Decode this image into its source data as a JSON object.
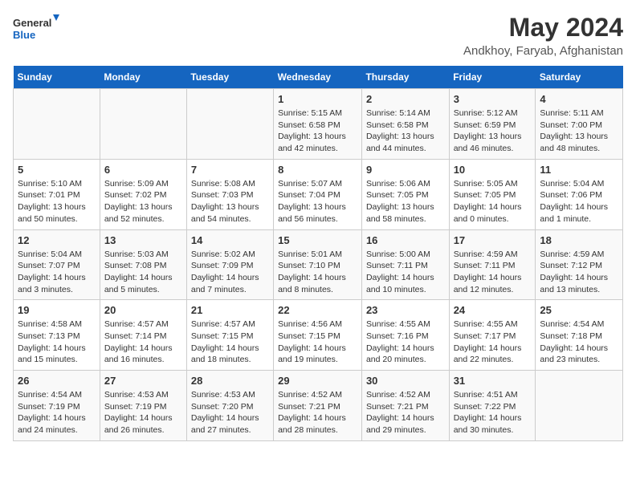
{
  "logo": {
    "general": "General",
    "blue": "Blue"
  },
  "title": "May 2024",
  "subtitle": "Andkhoy, Faryab, Afghanistan",
  "headers": [
    "Sunday",
    "Monday",
    "Tuesday",
    "Wednesday",
    "Thursday",
    "Friday",
    "Saturday"
  ],
  "weeks": [
    [
      {
        "day": "",
        "sunrise": "",
        "sunset": "",
        "daylight": ""
      },
      {
        "day": "",
        "sunrise": "",
        "sunset": "",
        "daylight": ""
      },
      {
        "day": "",
        "sunrise": "",
        "sunset": "",
        "daylight": ""
      },
      {
        "day": "1",
        "sunrise": "5:15 AM",
        "sunset": "6:58 PM",
        "daylight": "13 hours and 42 minutes."
      },
      {
        "day": "2",
        "sunrise": "5:14 AM",
        "sunset": "6:58 PM",
        "daylight": "13 hours and 44 minutes."
      },
      {
        "day": "3",
        "sunrise": "5:12 AM",
        "sunset": "6:59 PM",
        "daylight": "13 hours and 46 minutes."
      },
      {
        "day": "4",
        "sunrise": "5:11 AM",
        "sunset": "7:00 PM",
        "daylight": "13 hours and 48 minutes."
      }
    ],
    [
      {
        "day": "5",
        "sunrise": "5:10 AM",
        "sunset": "7:01 PM",
        "daylight": "13 hours and 50 minutes."
      },
      {
        "day": "6",
        "sunrise": "5:09 AM",
        "sunset": "7:02 PM",
        "daylight": "13 hours and 52 minutes."
      },
      {
        "day": "7",
        "sunrise": "5:08 AM",
        "sunset": "7:03 PM",
        "daylight": "13 hours and 54 minutes."
      },
      {
        "day": "8",
        "sunrise": "5:07 AM",
        "sunset": "7:04 PM",
        "daylight": "13 hours and 56 minutes."
      },
      {
        "day": "9",
        "sunrise": "5:06 AM",
        "sunset": "7:05 PM",
        "daylight": "13 hours and 58 minutes."
      },
      {
        "day": "10",
        "sunrise": "5:05 AM",
        "sunset": "7:05 PM",
        "daylight": "14 hours and 0 minutes."
      },
      {
        "day": "11",
        "sunrise": "5:04 AM",
        "sunset": "7:06 PM",
        "daylight": "14 hours and 1 minute."
      }
    ],
    [
      {
        "day": "12",
        "sunrise": "5:04 AM",
        "sunset": "7:07 PM",
        "daylight": "14 hours and 3 minutes."
      },
      {
        "day": "13",
        "sunrise": "5:03 AM",
        "sunset": "7:08 PM",
        "daylight": "14 hours and 5 minutes."
      },
      {
        "day": "14",
        "sunrise": "5:02 AM",
        "sunset": "7:09 PM",
        "daylight": "14 hours and 7 minutes."
      },
      {
        "day": "15",
        "sunrise": "5:01 AM",
        "sunset": "7:10 PM",
        "daylight": "14 hours and 8 minutes."
      },
      {
        "day": "16",
        "sunrise": "5:00 AM",
        "sunset": "7:11 PM",
        "daylight": "14 hours and 10 minutes."
      },
      {
        "day": "17",
        "sunrise": "4:59 AM",
        "sunset": "7:11 PM",
        "daylight": "14 hours and 12 minutes."
      },
      {
        "day": "18",
        "sunrise": "4:59 AM",
        "sunset": "7:12 PM",
        "daylight": "14 hours and 13 minutes."
      }
    ],
    [
      {
        "day": "19",
        "sunrise": "4:58 AM",
        "sunset": "7:13 PM",
        "daylight": "14 hours and 15 minutes."
      },
      {
        "day": "20",
        "sunrise": "4:57 AM",
        "sunset": "7:14 PM",
        "daylight": "14 hours and 16 minutes."
      },
      {
        "day": "21",
        "sunrise": "4:57 AM",
        "sunset": "7:15 PM",
        "daylight": "14 hours and 18 minutes."
      },
      {
        "day": "22",
        "sunrise": "4:56 AM",
        "sunset": "7:15 PM",
        "daylight": "14 hours and 19 minutes."
      },
      {
        "day": "23",
        "sunrise": "4:55 AM",
        "sunset": "7:16 PM",
        "daylight": "14 hours and 20 minutes."
      },
      {
        "day": "24",
        "sunrise": "4:55 AM",
        "sunset": "7:17 PM",
        "daylight": "14 hours and 22 minutes."
      },
      {
        "day": "25",
        "sunrise": "4:54 AM",
        "sunset": "7:18 PM",
        "daylight": "14 hours and 23 minutes."
      }
    ],
    [
      {
        "day": "26",
        "sunrise": "4:54 AM",
        "sunset": "7:19 PM",
        "daylight": "14 hours and 24 minutes."
      },
      {
        "day": "27",
        "sunrise": "4:53 AM",
        "sunset": "7:19 PM",
        "daylight": "14 hours and 26 minutes."
      },
      {
        "day": "28",
        "sunrise": "4:53 AM",
        "sunset": "7:20 PM",
        "daylight": "14 hours and 27 minutes."
      },
      {
        "day": "29",
        "sunrise": "4:52 AM",
        "sunset": "7:21 PM",
        "daylight": "14 hours and 28 minutes."
      },
      {
        "day": "30",
        "sunrise": "4:52 AM",
        "sunset": "7:21 PM",
        "daylight": "14 hours and 29 minutes."
      },
      {
        "day": "31",
        "sunrise": "4:51 AM",
        "sunset": "7:22 PM",
        "daylight": "14 hours and 30 minutes."
      },
      {
        "day": "",
        "sunrise": "",
        "sunset": "",
        "daylight": ""
      }
    ]
  ]
}
